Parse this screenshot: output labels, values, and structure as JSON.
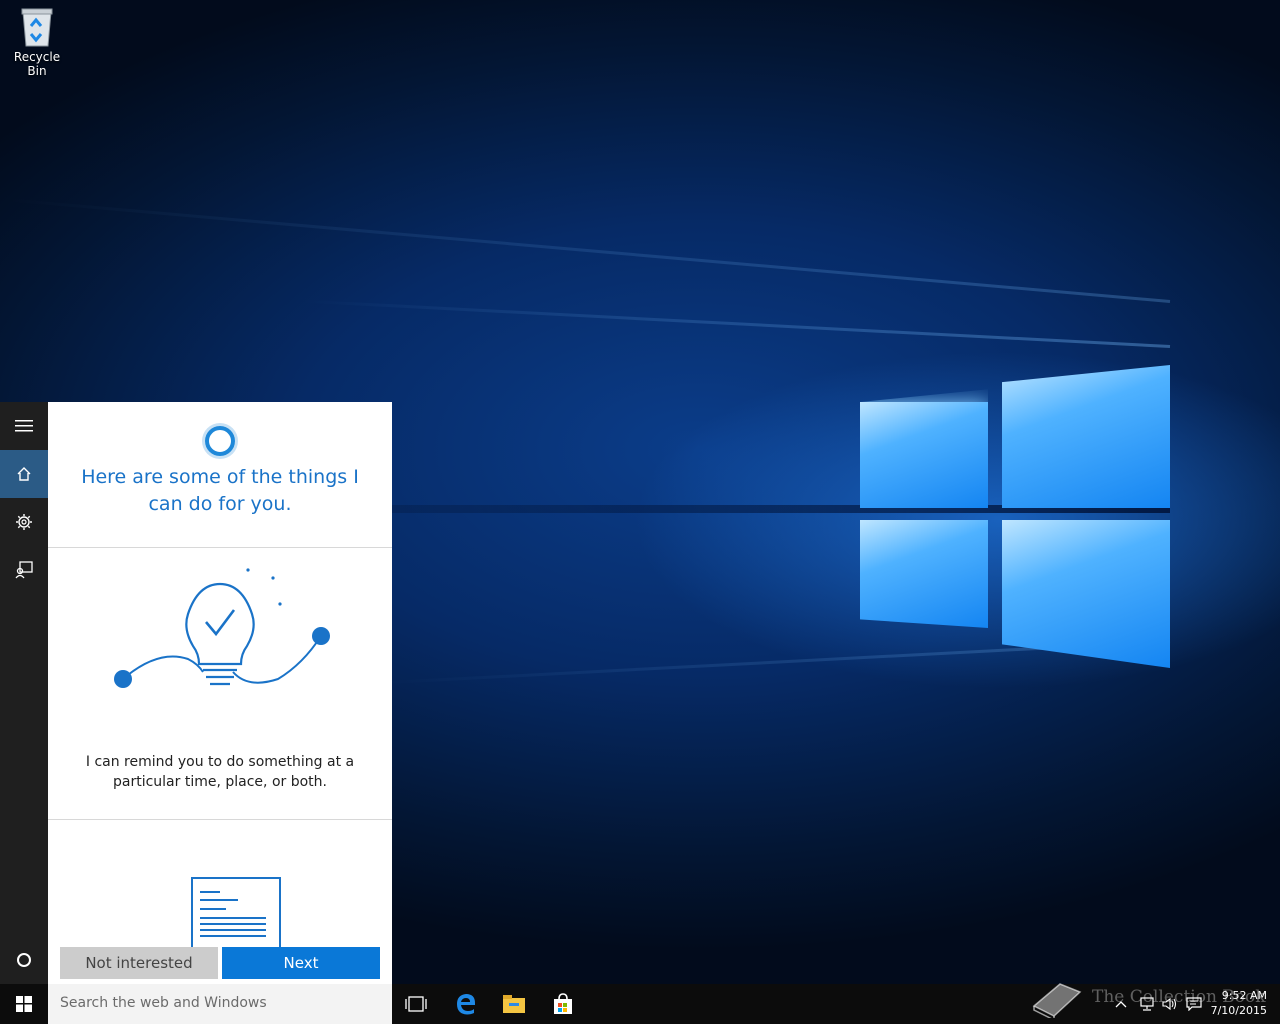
{
  "desktop": {
    "icons": [
      {
        "label": "Recycle Bin",
        "icon": "recycle-bin-icon"
      }
    ]
  },
  "cortana": {
    "sidebar": {
      "items": [
        {
          "name": "hamburger-menu-icon"
        },
        {
          "name": "home-icon",
          "active": true
        },
        {
          "name": "settings-gear-icon"
        },
        {
          "name": "feedback-icon"
        }
      ]
    },
    "title": "Here are some of the things I can do for you.",
    "cards": [
      {
        "illustration": "lightbulb-reminder-icon",
        "text": "I can remind you to do something at a particular time, place, or both."
      },
      {
        "illustration": "document-icon",
        "text": ""
      }
    ],
    "buttons": {
      "not_interested": "Not interested",
      "next": "Next"
    }
  },
  "taskbar": {
    "search_placeholder": "Search the web and Windows",
    "pinned": [
      "task-view-icon",
      "edge-icon",
      "file-explorer-icon",
      "store-icon"
    ],
    "clock": {
      "time": "9:52 AM",
      "date": "7/10/2015"
    },
    "watermark": "The Collection Book"
  },
  "colors": {
    "accent": "#0a78d7",
    "title_blue": "#1a73c8",
    "sidebar": "#1f1f1f",
    "taskbar": "#0c0c0c"
  }
}
